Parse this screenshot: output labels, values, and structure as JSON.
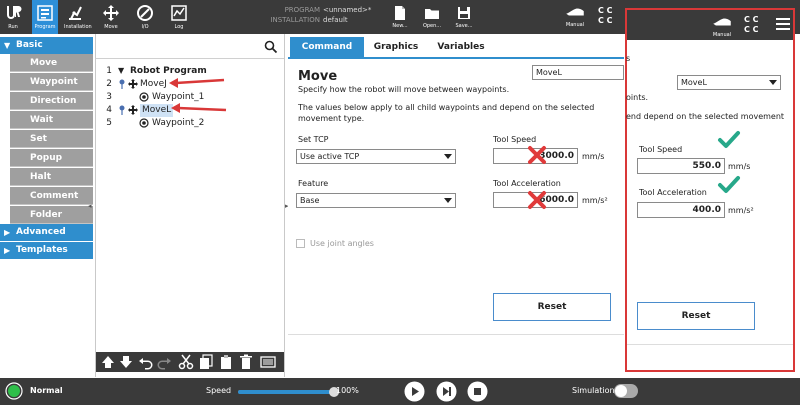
{
  "topbar": {
    "nav": [
      {
        "label": "Run",
        "icon": "ur-logo-icon"
      },
      {
        "label": "Program",
        "icon": "program-icon"
      },
      {
        "label": "Installation",
        "icon": "installation-icon"
      },
      {
        "label": "Move",
        "icon": "move-icon"
      },
      {
        "label": "I/O",
        "icon": "io-icon"
      },
      {
        "label": "Log",
        "icon": "log-icon"
      }
    ],
    "program_key": "PROGRAM",
    "program_value": "<unnamed>*",
    "installation_key": "INSTALLATION",
    "installation_value": "default",
    "file_ops": [
      {
        "label": "New...",
        "icon": "new-file-icon"
      },
      {
        "label": "Open...",
        "icon": "open-folder-icon"
      },
      {
        "label": "Save...",
        "icon": "save-icon"
      }
    ],
    "mode_label": "Manual"
  },
  "sidebar": {
    "sections": [
      {
        "label": "Basic",
        "expanded": true
      },
      {
        "label": "Advanced",
        "expanded": false
      },
      {
        "label": "Templates",
        "expanded": false
      }
    ],
    "basic_items": [
      "Move",
      "Waypoint",
      "Direction",
      "Wait",
      "Set",
      "Popup",
      "Halt",
      "Comment",
      "Folder"
    ]
  },
  "tree": {
    "rows": [
      {
        "num": "1",
        "text": "Robot Program",
        "bold": true
      },
      {
        "num": "2",
        "text": "MoveJ"
      },
      {
        "num": "3",
        "text": "Waypoint_1"
      },
      {
        "num": "4",
        "text": "MoveL"
      },
      {
        "num": "5",
        "text": "Waypoint_2"
      }
    ]
  },
  "command": {
    "tabs": [
      "Command",
      "Graphics",
      "Variables"
    ],
    "title": "Move",
    "subtitle": "Specify how the robot will move between waypoints.",
    "move_type": "MoveL",
    "description": "The values below apply to all child waypoints and depend on the selected movement type.",
    "set_tcp_label": "Set TCP",
    "set_tcp_value": "Use active TCP",
    "feature_label": "Feature",
    "feature_value": "Base",
    "tool_speed_label": "Tool Speed",
    "tool_speed_value": "3000.0",
    "tool_speed_unit": "mm/s",
    "tool_accel_label": "Tool Acceleration",
    "tool_accel_value": "6000.0",
    "tool_accel_unit": "mm/s²",
    "joint_angles_label": "Use joint angles",
    "reset_label": "Reset"
  },
  "highlight": {
    "partial_s": "s",
    "move_type": "MoveL",
    "frag1": "oints.",
    "frag2": "end depend on the selected movement",
    "tool_speed_label": "Tool Speed",
    "tool_speed_value": "550.0",
    "tool_speed_unit": "mm/s",
    "tool_accel_label": "Tool Acceleration",
    "tool_accel_value": "400.0",
    "tool_accel_unit": "mm/s²",
    "reset_label": "Reset",
    "mode_label": "Manual"
  },
  "footer": {
    "status": "Normal",
    "speed_label": "Speed",
    "speed_value": "100%",
    "speed_fraction": 1.0,
    "simulation_label": "Simulation"
  },
  "colors": {
    "accent": "#2f8ecd",
    "error": "#e03a3a",
    "ok": "#27a88a",
    "status": "#2fbf4a",
    "annotation": "#d93838"
  }
}
